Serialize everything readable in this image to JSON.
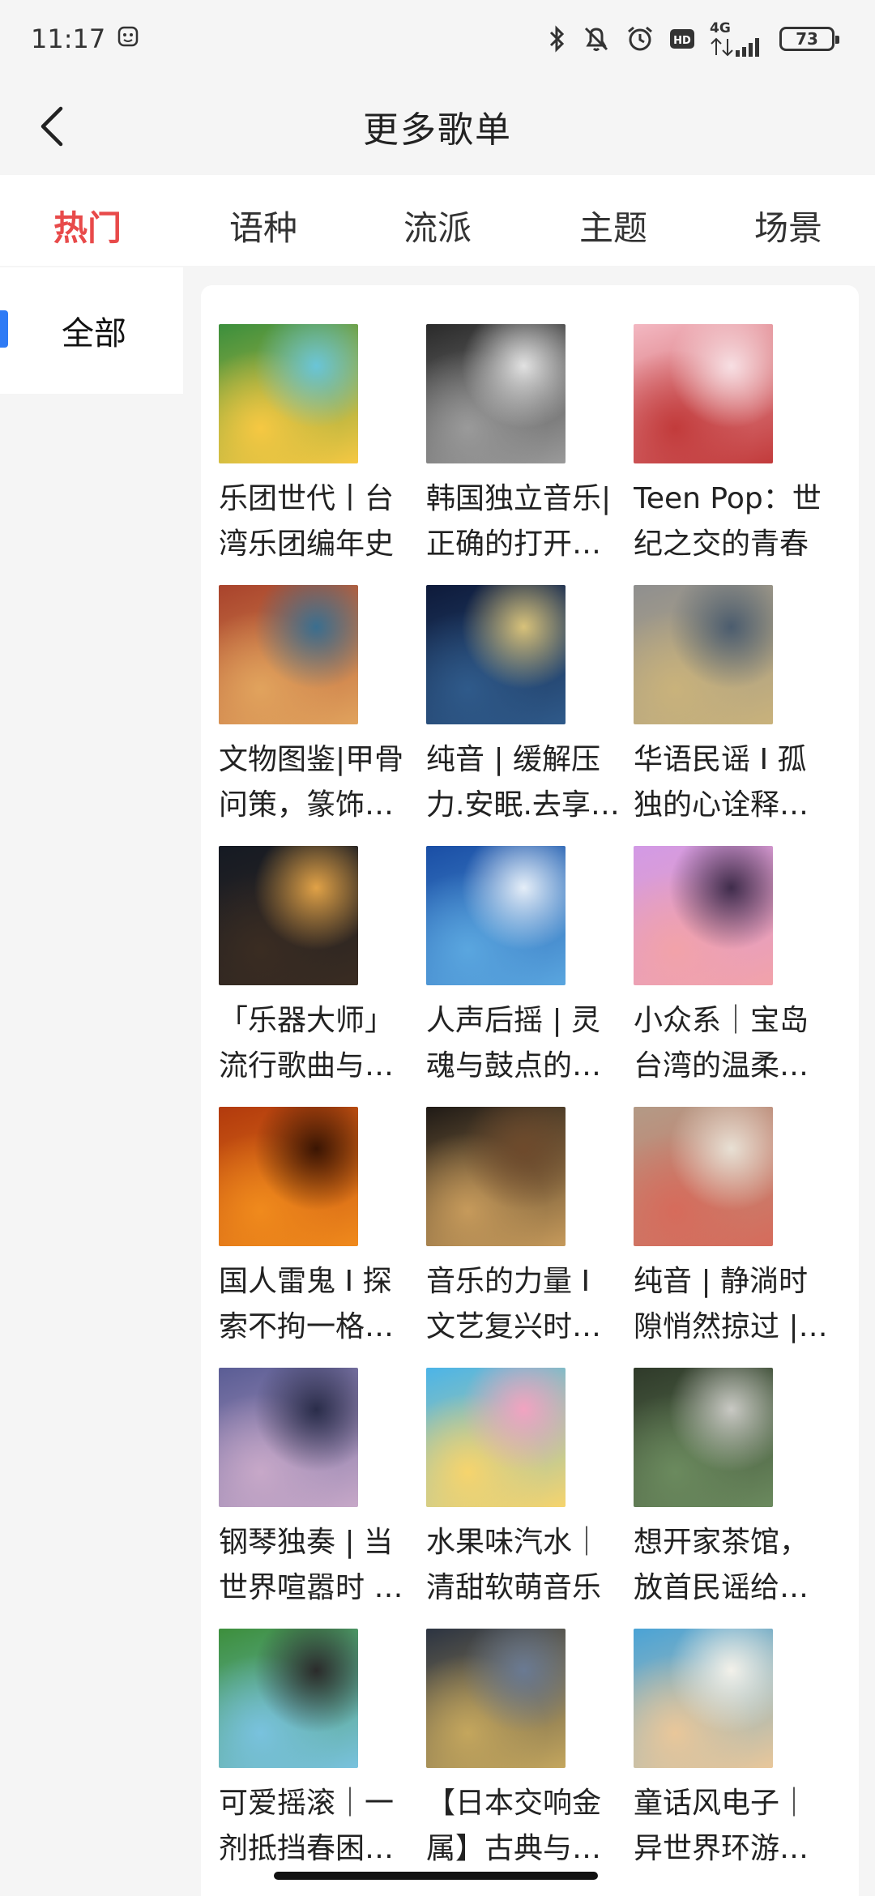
{
  "status": {
    "time": "11:17",
    "network": "4G",
    "battery": "73"
  },
  "header": {
    "title": "更多歌单"
  },
  "tabs": [
    {
      "label": "热门",
      "active": true
    },
    {
      "label": "语种",
      "active": false
    },
    {
      "label": "流派",
      "active": false
    },
    {
      "label": "主题",
      "active": false
    },
    {
      "label": "场景",
      "active": false
    }
  ],
  "sidebar": {
    "items": [
      {
        "label": "全部",
        "active": true
      }
    ]
  },
  "playlists": [
    {
      "title": "乐团世代丨台湾乐团编年史",
      "cover": [
        "#3b8f3d",
        "#f6c842",
        "#6ac5d8"
      ]
    },
    {
      "title": "韩国独立音乐|正确的打开方式",
      "cover": [
        "#2a2a2a",
        "#9a9a9a",
        "#e2e2e2"
      ]
    },
    {
      "title": "Teen Pop：世纪之交的青春",
      "cover": [
        "#f3b8c2",
        "#c23b3b",
        "#f7dfe3"
      ]
    },
    {
      "title": "文物图鉴|甲骨问策，篆饰华章",
      "cover": [
        "#a9432c",
        "#e1a35d",
        "#3a6e8f"
      ]
    },
    {
      "title": "纯音 | 缓解压力.安眠.去享受星空",
      "cover": [
        "#0e1a3a",
        "#2f5a8a",
        "#d8c27a"
      ]
    },
    {
      "title": "华语民谣 I 孤独的心诠释自由",
      "cover": [
        "#8f8f8f",
        "#c9b27b",
        "#4b5c6e"
      ]
    },
    {
      "title": "「乐器大师」流行歌曲与乐器",
      "cover": [
        "#151a23",
        "#3a2c22",
        "#e1a247"
      ]
    },
    {
      "title": "人声后摇 | 灵魂与鼓点的共鸣",
      "cover": [
        "#1a4ea5",
        "#5aa6df",
        "#e5eef8"
      ]
    },
    {
      "title": "小众系｜宝岛台湾的温柔时光",
      "cover": [
        "#d29ae6",
        "#f2a2a9",
        "#3f2c4b"
      ]
    },
    {
      "title": "国人雷鬼 I 探索不拘一格的律动",
      "cover": [
        "#b23a0d",
        "#f08a1c",
        "#3a1503"
      ]
    },
    {
      "title": "音乐的力量 I 文艺复兴时期的艺术",
      "cover": [
        "#1f1a16",
        "#c69a5b",
        "#6e4a2c"
      ]
    },
    {
      "title": "纯音 | 静淌时隙悄然掠过 | 放松",
      "cover": [
        "#b39a86",
        "#d66b5b",
        "#e8e0d4"
      ]
    },
    {
      "title": "钢琴独奏 | 当世界喧嚣时 静听",
      "cover": [
        "#5a5d95",
        "#c7a8c8",
        "#2a2d4a"
      ]
    },
    {
      "title": "水果味汽水｜清甜软萌音乐",
      "cover": [
        "#4bb4e8",
        "#f6d46d",
        "#f2a3c1"
      ]
    },
    {
      "title": "想开家茶馆，放首民谣给你听",
      "cover": [
        "#2f3a2a",
        "#6b8a5e",
        "#c9c9c4"
      ]
    },
    {
      "title": "可爱摇滚｜一剂抵挡春困的良药",
      "cover": [
        "#3d8f3c",
        "#79c2de",
        "#2b2b2b"
      ]
    },
    {
      "title": "【日本交响金属】古典与重金属",
      "cover": [
        "#2c3442",
        "#c4a65d",
        "#6a7a93"
      ]
    },
    {
      "title": "童话风电子｜异世界环游之旅",
      "cover": [
        "#4aa3d6",
        "#e9c79a",
        "#f3f1ea"
      ]
    }
  ]
}
